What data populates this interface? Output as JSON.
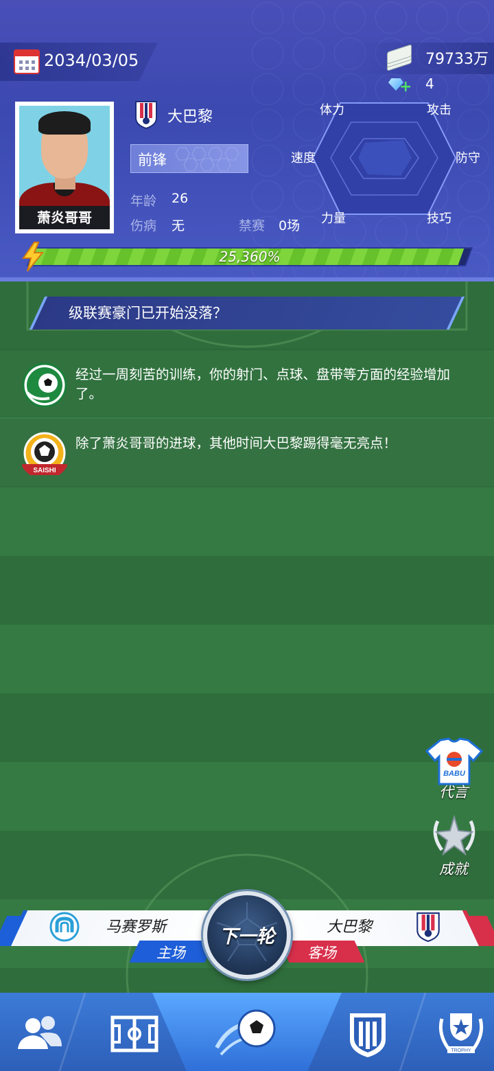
{
  "header": {
    "date": "2034/03/05",
    "money": "79733万",
    "gems": "4"
  },
  "player": {
    "name": "萧炎哥哥",
    "club": "大巴黎",
    "position": "前锋",
    "age_label": "年龄",
    "age": "26",
    "injury_label": "伤病",
    "injury": "无",
    "ban_label": "禁赛",
    "ban": "0场",
    "radar": {
      "labels": [
        "攻击",
        "防守",
        "技巧",
        "力量",
        "速度",
        "体力"
      ]
    },
    "progress_text": "25,360%",
    "progress_fraction": 0.985
  },
  "news": {
    "headline": "级联赛豪门已开始没落？",
    "items": [
      {
        "icon": "football-icon",
        "text": "经过一周刻苦的训练，你的射门、点球、盘带等方面的经验增加了。"
      },
      {
        "icon": "saishi-badge-icon",
        "badge_text": "SAISHI",
        "text": "除了萧炎哥哥的进球，其他时间大巴黎踢得毫无亮点！"
      }
    ]
  },
  "side_buttons": {
    "endorse": {
      "label": "代言",
      "shirt_text": "BABU"
    },
    "achievement": {
      "label": "成就"
    }
  },
  "match": {
    "home_team": "马赛罗斯",
    "home_tag": "主场",
    "away_team": "大巴黎",
    "away_tag": "客场",
    "next_label": "下一轮"
  },
  "nav": {
    "items": [
      "team-icon",
      "pitch-icon",
      "match-icon",
      "club-icon",
      "trophy-icon"
    ],
    "trophy_text": "TROPHY"
  },
  "colors": {
    "header_bg": "#4a4fb8",
    "progress_green": "#7ed63c",
    "home_blue": "#1c5fd8",
    "away_red": "#d8304b",
    "nav_blue": "#3c7bd8"
  }
}
